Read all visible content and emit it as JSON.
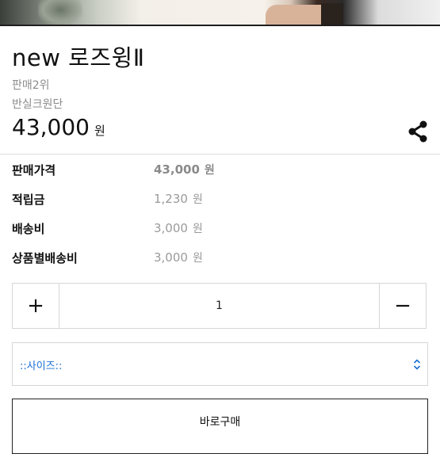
{
  "product": {
    "name": "new 로즈윙Ⅱ",
    "rank": "판매2위",
    "fabric": "반실크원단",
    "price": "43,000",
    "currency": "원"
  },
  "details": [
    {
      "label": "판매가격",
      "value": "43,000",
      "unit": "원"
    },
    {
      "label": "적립금",
      "value": "1,230",
      "unit": "원"
    },
    {
      "label": "배송비",
      "value": "3,000",
      "unit": "원"
    },
    {
      "label": "상품별배송비",
      "value": "3,000",
      "unit": "원"
    }
  ],
  "quantity": {
    "plus": "+",
    "value": "1",
    "minus": "−"
  },
  "size_select": {
    "selected": "::사이즈::"
  },
  "buy_button": {
    "label": "바로구매"
  },
  "icons": {
    "share": "share-icon",
    "select_arrows": "updown-chevron-icon"
  },
  "colors": {
    "select_text": "#1a6fd6",
    "muted_text": "#9a9a9a"
  }
}
